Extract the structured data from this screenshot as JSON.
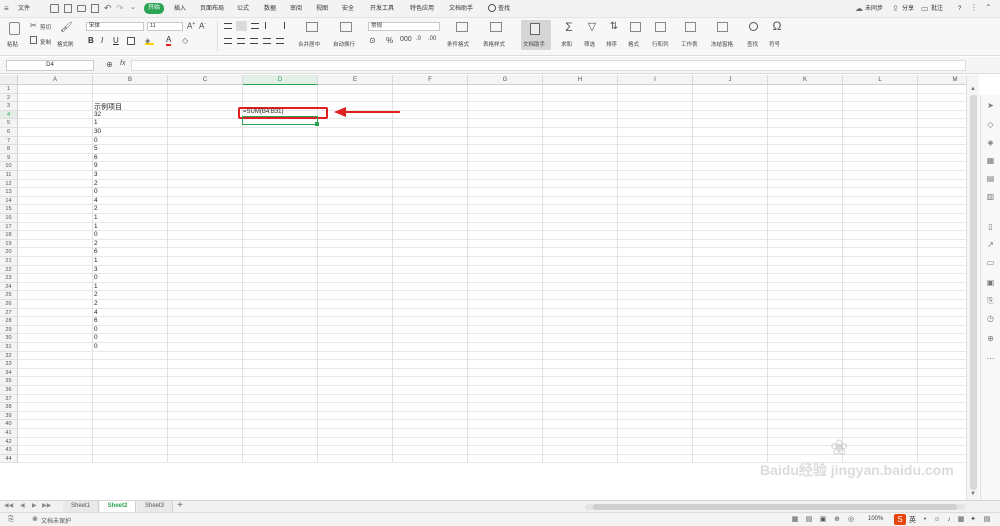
{
  "menubar": {
    "file_label": "文件",
    "tabs": [
      {
        "label": "开始",
        "active": true
      },
      {
        "label": "插入"
      },
      {
        "label": "页面布局"
      },
      {
        "label": "公式"
      },
      {
        "label": "数据"
      },
      {
        "label": "审阅"
      },
      {
        "label": "视图"
      },
      {
        "label": "安全"
      },
      {
        "label": "开发工具"
      },
      {
        "label": "特色应用"
      },
      {
        "label": "文档助手"
      },
      {
        "label": "查找"
      }
    ],
    "sync_label": "未同步",
    "share_label": "分享",
    "comment_label": "批注",
    "help_label": "?"
  },
  "ribbon": {
    "paste_label": "粘贴",
    "cut_label": "剪切",
    "copy_label": "复制",
    "format_painter_label": "格式刷",
    "font_name": "宋体",
    "font_size": "11",
    "merge_label": "合并居中",
    "wrap_label": "自动换行",
    "number_format": "常规",
    "conditional_format_label": "条件格式",
    "table_style_label": "表格样式",
    "doc_helper_label": "文档助手",
    "sum_label": "求和",
    "filter_label": "筛选",
    "sort_label": "排序",
    "format_label": "格式",
    "rowcol_label": "行和列",
    "worksheet_label": "工作表",
    "freeze_label": "冻结窗格",
    "find_label": "查找",
    "symbol_label": "符号",
    "accent_color": "#2aa452"
  },
  "formula_bar": {
    "name_box": "D4",
    "fx_label": "fx",
    "formula": ""
  },
  "columns": [
    "A",
    "B",
    "C",
    "D",
    "E",
    "F",
    "G",
    "H",
    "I",
    "J",
    "K",
    "L",
    "M"
  ],
  "rows": [
    "1",
    "2",
    "3",
    "4",
    "5",
    "6",
    "7",
    "8",
    "9",
    "10",
    "11",
    "12",
    "13",
    "14",
    "15",
    "16",
    "17",
    "18",
    "19",
    "20",
    "21",
    "22",
    "23",
    "24",
    "25",
    "26",
    "27",
    "28",
    "29",
    "30",
    "31",
    "32",
    "33",
    "34",
    "35",
    "36",
    "37",
    "38",
    "39",
    "40",
    "41",
    "42",
    "43",
    "44"
  ],
  "cells": {
    "B3": "示例项目",
    "D3": "=SUM(B4:B31)",
    "B_values": [
      "32",
      "1",
      "30",
      "0",
      "5",
      "6",
      "9",
      "3",
      "2",
      "0",
      "4",
      "2",
      "1",
      "1",
      "0",
      "2",
      "6",
      "1",
      "3",
      "0",
      "1",
      "2",
      "2",
      "4",
      "6",
      "0",
      "0",
      "0"
    ]
  },
  "annotation": {
    "highlight_color": "#e02020"
  },
  "sheets": [
    {
      "label": "Sheet1"
    },
    {
      "label": "Sheet2",
      "active": true
    },
    {
      "label": "Sheet3"
    }
  ],
  "add_sheet_label": "+",
  "status": {
    "protection_label": "文档未保护",
    "zoom": "100%",
    "ime_label": "英"
  },
  "watermark": "Baidu经验 jingyan.baidu.com"
}
